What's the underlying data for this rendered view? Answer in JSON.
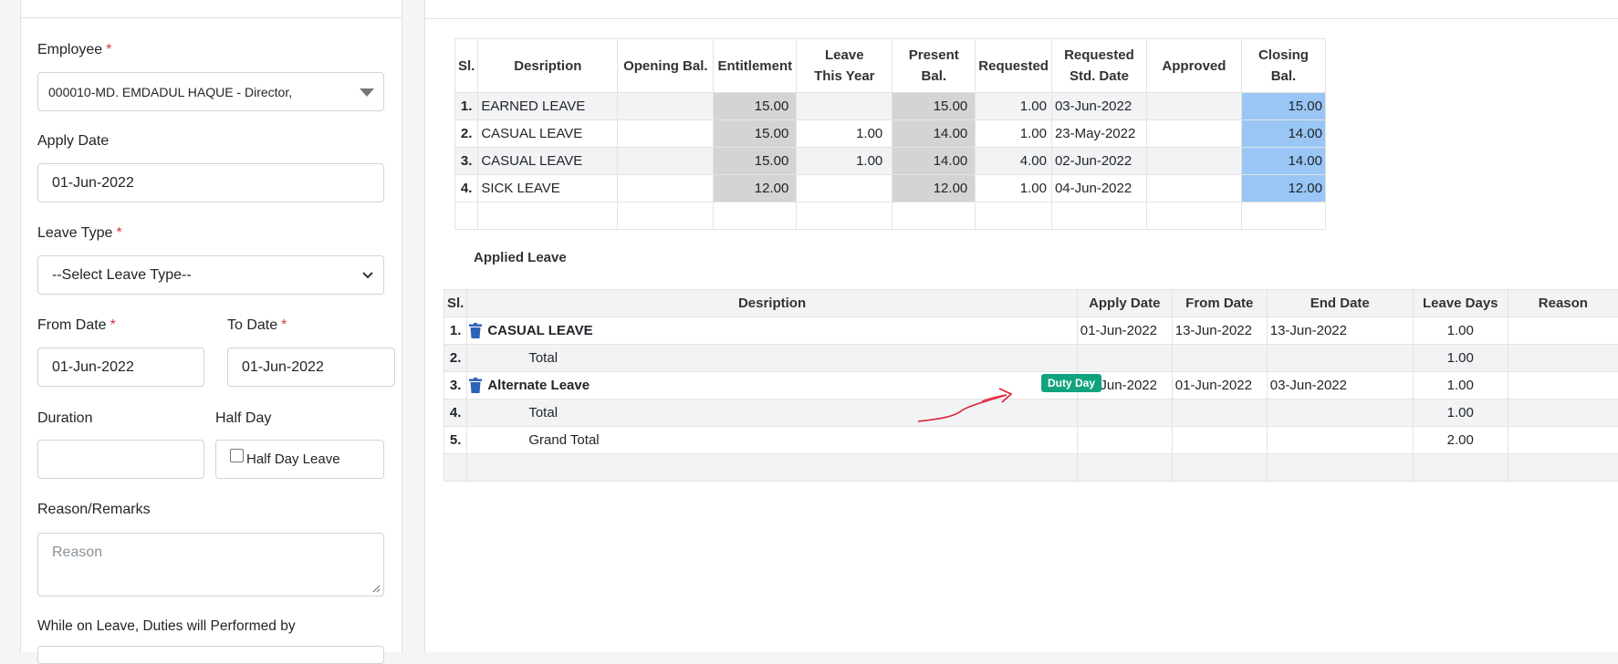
{
  "form": {
    "employee_label": "Employee",
    "employee_value": "000010-MD. EMDADUL HAQUE - Director,",
    "apply_date_label": "Apply Date",
    "apply_date_value": "01-Jun-2022",
    "leave_type_label": "Leave Type",
    "leave_type_value": "--Select Leave Type--",
    "from_date_label": "From Date",
    "from_date_value": "01-Jun-2022",
    "to_date_label": "To Date",
    "to_date_value": "01-Jun-2022",
    "duration_label": "Duration",
    "duration_value": "",
    "half_day_label": "Half Day",
    "half_day_checkbox_label": "Half Day Leave",
    "reason_label": "Reason/Remarks",
    "reason_placeholder": "Reason",
    "duties_label": "While on Leave, Duties will Performed by",
    "required_mark": "*"
  },
  "balance_table": {
    "headers": [
      "Sl.",
      "Desription",
      "Opening Bal.",
      "Entitlement",
      "Leave This Year",
      "Present Bal.",
      "Requested",
      "Requested Std. Date",
      "Approved",
      "Closing Bal."
    ],
    "header_lines": {
      "leave": [
        "Leave",
        "This Year"
      ],
      "present": [
        "Present",
        "Bal."
      ],
      "req_std": [
        "Requested",
        "Std. Date"
      ],
      "closing": [
        "Closing",
        "Bal."
      ]
    },
    "rows": [
      {
        "sl": "1.",
        "desc": "EARNED LEAVE",
        "opening": "",
        "entitlement": "15.00",
        "leave_this_year": "",
        "present": "15.00",
        "requested": "1.00",
        "std_date": "03-Jun-2022",
        "approved": "",
        "closing": "15.00"
      },
      {
        "sl": "2.",
        "desc": "CASUAL LEAVE",
        "opening": "",
        "entitlement": "15.00",
        "leave_this_year": "1.00",
        "present": "14.00",
        "requested": "1.00",
        "std_date": "23-May-2022",
        "approved": "",
        "closing": "14.00"
      },
      {
        "sl": "3.",
        "desc": "CASUAL LEAVE",
        "opening": "",
        "entitlement": "15.00",
        "leave_this_year": "1.00",
        "present": "14.00",
        "requested": "4.00",
        "std_date": "02-Jun-2022",
        "approved": "",
        "closing": "14.00"
      },
      {
        "sl": "4.",
        "desc": "SICK LEAVE",
        "opening": "",
        "entitlement": "12.00",
        "leave_this_year": "",
        "present": "12.00",
        "requested": "1.00",
        "std_date": "04-Jun-2022",
        "approved": "",
        "closing": "12.00"
      }
    ]
  },
  "applied_leave": {
    "title": "Applied Leave",
    "headers": [
      "Sl.",
      "Desription",
      "Apply Date",
      "From Date",
      "End Date",
      "Leave Days",
      "Reason"
    ],
    "rows": [
      {
        "sl": "1.",
        "desc": "CASUAL LEAVE",
        "apply": "01-Jun-2022",
        "from": "13-Jun-2022",
        "end": "13-Jun-2022",
        "days": "1.00",
        "reason": ""
      },
      {
        "sl": "2.",
        "desc": "Total",
        "apply": "",
        "from": "",
        "end": "",
        "days": "1.00",
        "reason": ""
      },
      {
        "sl": "3.",
        "desc": "Alternate Leave",
        "apply": "01-Jun-2022",
        "from": "01-Jun-2022",
        "end": "03-Jun-2022",
        "days": "1.00",
        "reason": ""
      },
      {
        "sl": "4.",
        "desc": "Total",
        "apply": "",
        "from": "",
        "end": "",
        "days": "1.00",
        "reason": ""
      },
      {
        "sl": "5.",
        "desc": "Grand Total",
        "apply": "",
        "from": "",
        "end": "",
        "days": "2.00",
        "reason": ""
      }
    ],
    "badge": "Duty Day"
  },
  "colors": {
    "trash": "#2f63b8",
    "badge": "#11a37f",
    "annotation": "#e0203a",
    "closing_bg": "#99c6f5",
    "gray_bg": "#d4d4d4"
  }
}
